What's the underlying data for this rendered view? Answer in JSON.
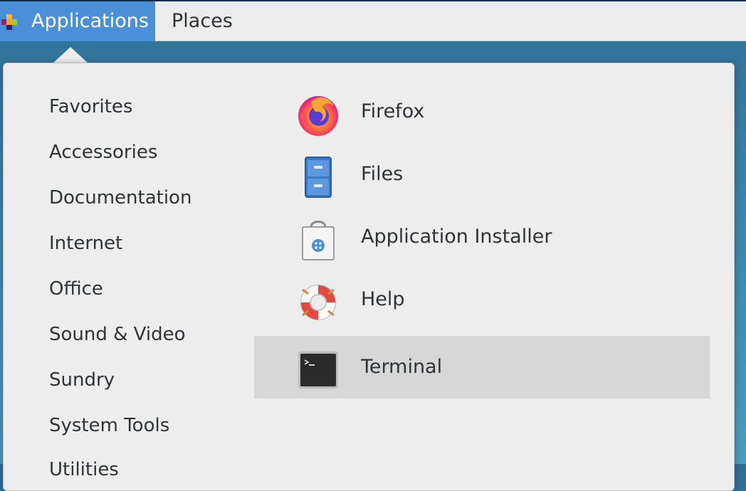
{
  "topbar": {
    "applications_label": "Applications",
    "places_label": "Places"
  },
  "categories": [
    "Favorites",
    "Accessories",
    "Documentation",
    "Internet",
    "Office",
    "Sound & Video",
    "Sundry",
    "System Tools",
    "Utilities"
  ],
  "apps": [
    {
      "name": "Firefox",
      "icon": "firefox-icon"
    },
    {
      "name": "Files",
      "icon": "files-icon"
    },
    {
      "name": "Application Installer",
      "icon": "application-installer-icon"
    },
    {
      "name": "Help",
      "icon": "help-icon"
    },
    {
      "name": "Terminal",
      "icon": "terminal-icon"
    }
  ],
  "colors": {
    "accent": "#4a90d9",
    "selected_row": "#d6d7d6",
    "popup_bg": "#ededed",
    "topbar_bg": "#ececec"
  }
}
